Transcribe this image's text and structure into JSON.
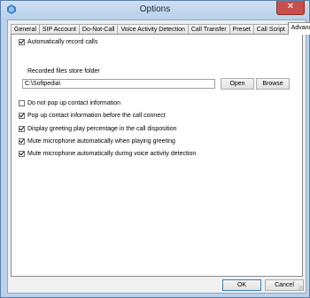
{
  "window": {
    "title": "Options",
    "close_glyph": "✕",
    "app_icon": "app-icon"
  },
  "tabs": [
    {
      "label": "General"
    },
    {
      "label": "SIP Account"
    },
    {
      "label": "Do-Not-Call"
    },
    {
      "label": "Voice Activity Detection"
    },
    {
      "label": "Call Transfer"
    },
    {
      "label": "Preset"
    },
    {
      "label": "Call Script"
    },
    {
      "label": "Advanced",
      "active": true
    }
  ],
  "advanced": {
    "auto_record": {
      "label": "Automatically record calls",
      "checked": true
    },
    "folder_label": "Recorded files store folder",
    "folder_value": "C:\\Softpedia\\",
    "open_button": "Open",
    "browse_button": "Browse",
    "no_popup": {
      "label": "Do not pop up contact information",
      "checked": false
    },
    "popup_before": {
      "label": "Pop up contact information before the call connect",
      "checked": true
    },
    "display_greeting": {
      "label": "Display greeting play percentage in the call disposition",
      "checked": true
    },
    "mute_greeting": {
      "label": "Mute microphone automatically when playing greeting",
      "checked": true
    },
    "mute_vad": {
      "label": "Mute microphone automatically during voice activity detection",
      "checked": true
    }
  },
  "footer": {
    "ok_button": "OK",
    "cancel_button": "Cancel"
  }
}
